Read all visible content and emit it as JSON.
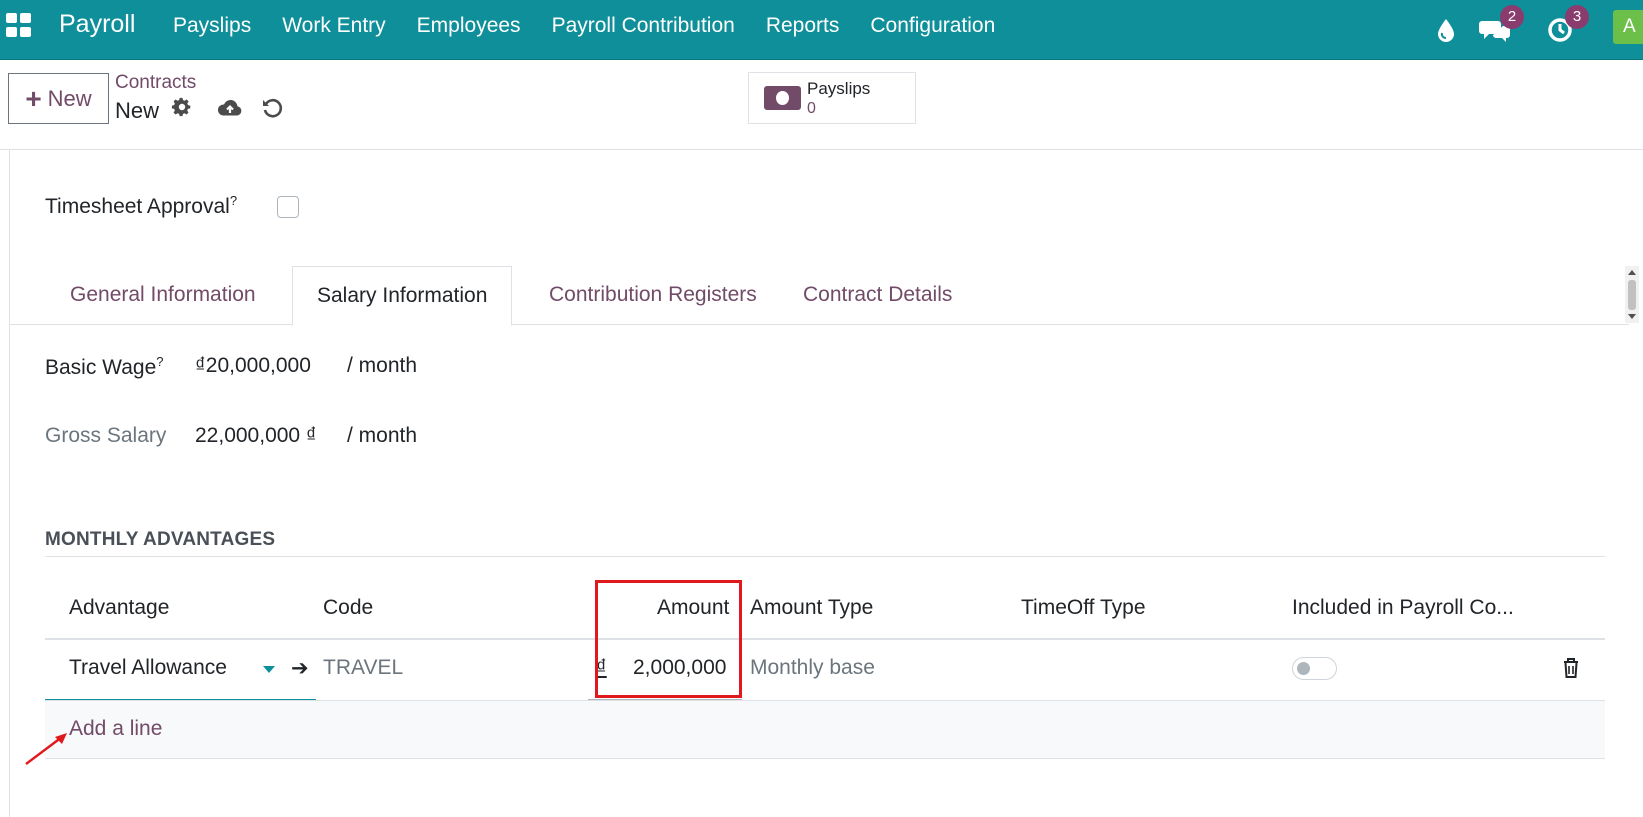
{
  "navbar": {
    "brand": "Payroll",
    "menu": [
      "Payslips",
      "Work Entry",
      "Employees",
      "Payroll Contribution",
      "Reports",
      "Configuration"
    ],
    "messages_count": "2",
    "activities_count": "3",
    "avatar_initial": "A",
    "colors": {
      "bar": "#0f8f9a",
      "badge": "#8a3c6e",
      "avatar": "#6cc04a"
    }
  },
  "control_panel": {
    "new_label": "New",
    "breadcrumb_parent": "Contracts",
    "breadcrumb_current": "New",
    "smart_button": {
      "label": "Payslips",
      "count": "0",
      "icon": "money-icon"
    }
  },
  "form": {
    "timesheet_approval_label": "Timesheet Approval",
    "help_mark": "?",
    "tabs": [
      "General Information",
      "Salary Information",
      "Contribution Registers",
      "Contract Details"
    ],
    "active_tab": "Salary Information",
    "basic_wage_label": "Basic Wage",
    "basic_wage_value": "₫20,000,000",
    "per_month": "/ month",
    "gross_salary_label": "Gross Salary",
    "gross_salary_value": "22,000,000 ₫",
    "section_title": "MONTHLY ADVANTAGES"
  },
  "table": {
    "headers": [
      "Advantage",
      "Code",
      "Amount",
      "Amount Type",
      "TimeOff Type",
      "Included in Payroll Co..."
    ],
    "rows": [
      {
        "advantage": "Travel Allowance",
        "code": "TRAVEL",
        "currency": "₫",
        "amount": "2,000,000",
        "amount_type": "Monthly base",
        "timeoff_type": "",
        "included_in_payroll": false
      }
    ],
    "add_line": "Add a line"
  },
  "accent_colors": {
    "primary": "#714b67",
    "highlight_box": "#e0191c"
  }
}
